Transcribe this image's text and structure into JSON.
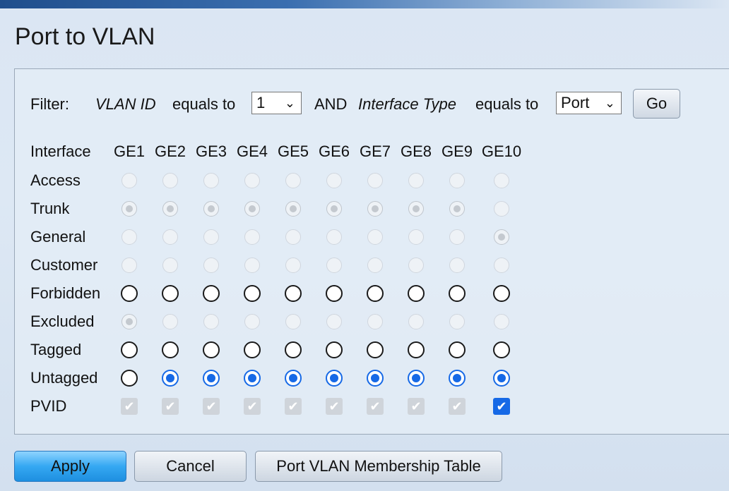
{
  "page": {
    "title": "Port to VLAN"
  },
  "filter": {
    "label": "Filter:",
    "field1": "VLAN ID",
    "op1": "equals to",
    "vlan_value": "1",
    "joiner": "AND",
    "field2": "Interface Type",
    "op2": "equals to",
    "type_value": "Port",
    "go_label": "Go"
  },
  "table": {
    "header_label": "Interface",
    "columns": [
      "GE1",
      "GE2",
      "GE3",
      "GE4",
      "GE5",
      "GE6",
      "GE7",
      "GE8",
      "GE9",
      "GE10"
    ],
    "rows": [
      {
        "label": "Access",
        "kind": "radio",
        "enabled": [
          0,
          0,
          0,
          0,
          0,
          0,
          0,
          0,
          0,
          0
        ],
        "selected": [
          0,
          0,
          0,
          0,
          0,
          0,
          0,
          0,
          0,
          0
        ]
      },
      {
        "label": "Trunk",
        "kind": "radio",
        "enabled": [
          0,
          0,
          0,
          0,
          0,
          0,
          0,
          0,
          0,
          0
        ],
        "selected": [
          1,
          1,
          1,
          1,
          1,
          1,
          1,
          1,
          1,
          0
        ]
      },
      {
        "label": "General",
        "kind": "radio",
        "enabled": [
          0,
          0,
          0,
          0,
          0,
          0,
          0,
          0,
          0,
          0
        ],
        "selected": [
          0,
          0,
          0,
          0,
          0,
          0,
          0,
          0,
          0,
          1
        ]
      },
      {
        "label": "Customer",
        "kind": "radio",
        "enabled": [
          0,
          0,
          0,
          0,
          0,
          0,
          0,
          0,
          0,
          0
        ],
        "selected": [
          0,
          0,
          0,
          0,
          0,
          0,
          0,
          0,
          0,
          0
        ]
      },
      {
        "label": "Forbidden",
        "kind": "radio",
        "enabled": [
          1,
          1,
          1,
          1,
          1,
          1,
          1,
          1,
          1,
          1
        ],
        "selected": [
          0,
          0,
          0,
          0,
          0,
          0,
          0,
          0,
          0,
          0
        ]
      },
      {
        "label": "Excluded",
        "kind": "radio",
        "enabled": [
          0,
          0,
          0,
          0,
          0,
          0,
          0,
          0,
          0,
          0
        ],
        "selected": [
          1,
          0,
          0,
          0,
          0,
          0,
          0,
          0,
          0,
          0
        ]
      },
      {
        "label": "Tagged",
        "kind": "radio",
        "enabled": [
          1,
          1,
          1,
          1,
          1,
          1,
          1,
          1,
          1,
          1
        ],
        "selected": [
          0,
          0,
          0,
          0,
          0,
          0,
          0,
          0,
          0,
          0
        ]
      },
      {
        "label": "Untagged",
        "kind": "radio",
        "enabled": [
          1,
          1,
          1,
          1,
          1,
          1,
          1,
          1,
          1,
          1
        ],
        "selected": [
          0,
          1,
          1,
          1,
          1,
          1,
          1,
          1,
          1,
          1
        ]
      },
      {
        "label": "PVID",
        "kind": "checkbox",
        "enabled": [
          0,
          0,
          0,
          0,
          0,
          0,
          0,
          0,
          0,
          1
        ],
        "selected": [
          1,
          1,
          1,
          1,
          1,
          1,
          1,
          1,
          1,
          1
        ]
      }
    ]
  },
  "buttons": {
    "apply": "Apply",
    "cancel": "Cancel",
    "membership": "Port VLAN Membership Table"
  },
  "colors": {
    "accent": "#1669e6",
    "disabled": "#cfd4da"
  }
}
